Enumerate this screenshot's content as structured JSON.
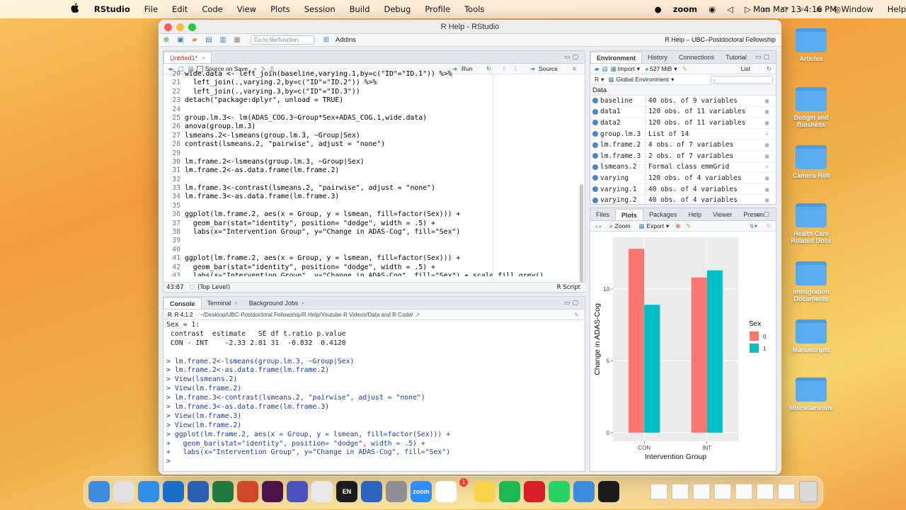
{
  "menubar": {
    "apple": "",
    "app_name": "RStudio",
    "menus": [
      "File",
      "Edit",
      "Code",
      "View",
      "Plots",
      "Session",
      "Build",
      "Debug",
      "Profile",
      "Tools"
    ],
    "right_items": [
      "Window",
      "Help"
    ],
    "zoom": "zoom",
    "datetime": "Mon Mar 13  4:16 PM"
  },
  "window": {
    "title": "R Help - RStudio",
    "goto_placeholder": "Go to file/function",
    "addins": "Addins",
    "project": "R Help – UBC–Postdoctoral Fellowship"
  },
  "editor": {
    "tab": "Untitled1*",
    "source_on_save": "Source on Save",
    "run": "Run",
    "source": "Source",
    "status_pos": "43:87",
    "status_scope": "(Top Level)",
    "status_type": "R Script",
    "lines": [
      {
        "n": "20",
        "t": "wide.data <- left_join(baseline,varying.1,by=c(\"ID\"=\"ID.1\")) %>%"
      },
      {
        "n": "21",
        "t": "  left_join(.,varying.2,by=c(\"ID\"=\"ID.2\")) %>%"
      },
      {
        "n": "22",
        "t": "  left_join(.,varying.3,by=c(\"ID\"=\"ID.3\"))"
      },
      {
        "n": "23",
        "t": "detach(\"package:dplyr\", unload = TRUE)"
      },
      {
        "n": "24",
        "t": ""
      },
      {
        "n": "25",
        "t": "group.lm.3<- lm(ADAS_COG.3~Group*Sex+ADAS_COG.1,wide.data)"
      },
      {
        "n": "26",
        "t": "anova(group.lm.3)"
      },
      {
        "n": "27",
        "t": "lsmeans.2<-lsmeans(group.lm.3, ~Group|Sex)"
      },
      {
        "n": "28",
        "t": "contrast(lsmeans.2, \"pairwise\", adjust = \"none\")"
      },
      {
        "n": "29",
        "t": ""
      },
      {
        "n": "30",
        "t": "lm.frame.2<-lsmeans(group.lm.3, ~Group|Sex)"
      },
      {
        "n": "31",
        "t": "lm.frame.2<-as.data.frame(lm.frame.2)"
      },
      {
        "n": "32",
        "t": ""
      },
      {
        "n": "33",
        "t": "lm.frame.3<-contrast(lsmeans.2, \"pairwise\", adjust = \"none\")"
      },
      {
        "n": "34",
        "t": "lm.frame.3<-as.data.frame(lm.frame.3)"
      },
      {
        "n": "35",
        "t": ""
      },
      {
        "n": "36",
        "t": "ggplot(lm.frame.2, aes(x = Group, y = lsmean, fill=factor(Sex))) +"
      },
      {
        "n": "37",
        "t": "  geom_bar(stat=\"identity\", position= \"dodge\", width = .5) +"
      },
      {
        "n": "38",
        "t": "  labs(x=\"Intervention Group\", y=\"Change in ADAS-Cog\", fill=\"Sex\")"
      },
      {
        "n": "39",
        "t": ""
      },
      {
        "n": "40",
        "t": ""
      },
      {
        "n": "41",
        "t": "ggplot(lm.frame.2, aes(x = Group, y = lsmean, fill=factor(Sex))) +"
      },
      {
        "n": "42",
        "t": "  geom_bar(stat=\"identity\", position= \"dodge\", width = .5) +"
      },
      {
        "n": "43",
        "t": "  labs(x=\"Intervention Group\", y=\"Change in ADAS-Cog\", fill=\"Sex\") + scale_fill_grey()"
      }
    ]
  },
  "console": {
    "tabs": [
      "Console",
      "Terminal",
      "Background Jobs"
    ],
    "r_version": "R 4.1.2",
    "path": "~/Desktop/UBC-Postdoctoral Fellowship/R Help/Youtube R Videos/Data and R Code/",
    "lines": [
      {
        "p": "",
        "t": "Sex = 1:"
      },
      {
        "p": "",
        "t": " contrast  estimate   SE df t.ratio p.value"
      },
      {
        "p": "",
        "t": " CON - INT    -2.33 2.81 31  -0.832  0.4120"
      },
      {
        "p": "",
        "t": ""
      },
      {
        "p": ">",
        "t": "lm.frame.2<-lsmeans(group.lm.3, ~Group|Sex)"
      },
      {
        "p": ">",
        "t": "lm.frame.2<-as.data.frame(lm.frame.2)"
      },
      {
        "p": ">",
        "t": "View(lsmeans.2)"
      },
      {
        "p": ">",
        "t": "View(lm.frame.2)"
      },
      {
        "p": ">",
        "t": "lm.frame.3<-contrast(lsmeans.2, \"pairwise\", adjust = \"none\")"
      },
      {
        "p": ">",
        "t": "lm.frame.3<-as.data.frame(lm.frame.3)"
      },
      {
        "p": ">",
        "t": "View(lm.frame.3)"
      },
      {
        "p": ">",
        "t": "View(lm.frame.2)"
      },
      {
        "p": ">",
        "t": "ggplot(lm.frame.2, aes(x = Group, y = lsmean, fill=factor(Sex))) +"
      },
      {
        "p": "+",
        "t": "  geom_bar(stat=\"identity\", position= \"dodge\", width = .5) +"
      },
      {
        "p": "+",
        "t": "  labs(x=\"Intervention Group\", y=\"Change in ADAS-Cog\", fill=\"Sex\")"
      },
      {
        "p": ">",
        "t": ""
      }
    ]
  },
  "environment": {
    "tabs": [
      "Environment",
      "History",
      "Connections",
      "Tutorial"
    ],
    "import": "Import",
    "memory": "527 MiB",
    "view": "List",
    "r_select": "R",
    "scope": "Global Environment",
    "section": "Data",
    "rows": [
      {
        "name": "baseline",
        "value": "40 obs. of 9 variables"
      },
      {
        "name": "data1",
        "value": "120 obs. of 11 variables"
      },
      {
        "name": "data2",
        "value": "120 obs. of 11 variables"
      },
      {
        "name": "group.lm.3",
        "value": "List of  14"
      },
      {
        "name": "lm.frame.2",
        "value": "4 obs. of 7 variables"
      },
      {
        "name": "lm.frame.3",
        "value": "2 obs. of 7 variables"
      },
      {
        "name": "lsmeans.2",
        "value": "Formal class  emmGrid"
      },
      {
        "name": "varying",
        "value": "120 obs. of 4 variables"
      },
      {
        "name": "varying.1",
        "value": "40 obs. of 4 variables"
      },
      {
        "name": "varying.2",
        "value": "40 obs. of 4 variables"
      }
    ]
  },
  "plots_pane": {
    "tabs": [
      "Files",
      "Plots",
      "Packages",
      "Help",
      "Viewer",
      "Presen"
    ],
    "zoom": "Zoom",
    "export": "Export"
  },
  "chart_data": {
    "type": "bar",
    "categories": [
      "CON",
      "INT"
    ],
    "series": [
      {
        "name": "0",
        "values": [
          12.8,
          10.8
        ]
      },
      {
        "name": "1",
        "values": [
          8.9,
          11.3
        ]
      }
    ],
    "xlabel": "Intervention Group",
    "ylabel": "Change in ADAS-Cog",
    "legend_title": "Sex",
    "ylim": [
      -0.6,
      13.6
    ],
    "yticks": [
      0,
      5,
      10
    ],
    "colors": [
      "#F8766D",
      "#00BFC4"
    ],
    "panel_bg": "#EBEBEB",
    "grid": true,
    "legend_position": "right"
  },
  "desktop": {
    "folders": [
      "Articles",
      "Budget and\nBuisness",
      "Camera Roll",
      "Health Care\nRelated Docs",
      "Immigration\nDocuments",
      "Manuscripts",
      "Miscellaneous"
    ]
  },
  "dock": {
    "apps": [
      "Finder",
      "Launchpad",
      "Safari",
      "Outlook",
      "Word",
      "Excel",
      "PowerPoint",
      "Slack",
      "Teams",
      "Chrome",
      "EN",
      "R",
      "System Settings",
      "zoom",
      "Calendar",
      "Notes",
      "Spotify",
      "Acrobat",
      "WhatsApp",
      "Xcode",
      "QuickTime"
    ],
    "en_label": "EN",
    "zoom_label": "zoom",
    "notif_badge": "1"
  }
}
